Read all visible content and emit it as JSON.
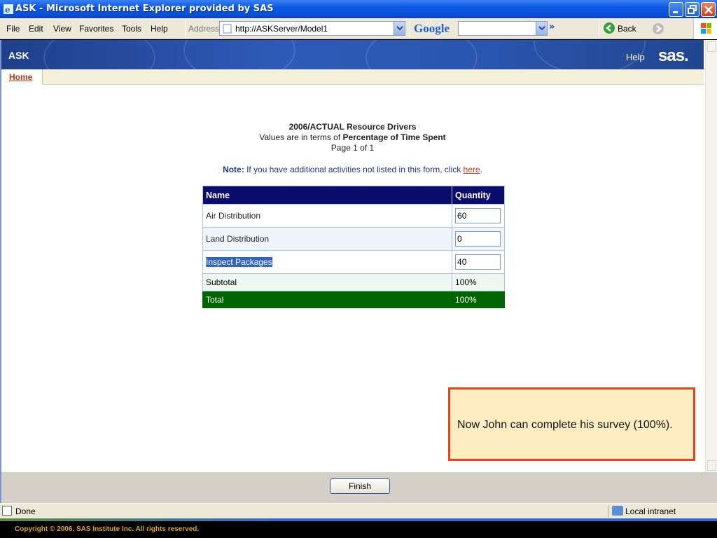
{
  "window": {
    "title": "ASK - Microsoft Internet Explorer provided by SAS"
  },
  "menu": {
    "file": "File",
    "edit": "Edit",
    "view": "View",
    "favorites": "Favorites",
    "tools": "Tools",
    "help": "Help"
  },
  "toolbar": {
    "address_label": "Address",
    "address_value": "http://ASKServer/Model1",
    "google_label": "Google",
    "back_label": "Back",
    "more": "»"
  },
  "app": {
    "name": "ASK",
    "help": "Help",
    "logo": "sas."
  },
  "tabs": [
    {
      "label": "Home"
    }
  ],
  "report": {
    "title": "2006/ACTUAL Resource Drivers",
    "values_prefix": "Values are in terms of ",
    "values_term": "Percentage of Time Spent",
    "page": "Page 1 of 1",
    "note_label": "Note:",
    "note_text": " If you have additional activities not listed in this form, click ",
    "note_link": "here",
    "note_end": "."
  },
  "table": {
    "headers": {
      "name": "Name",
      "quantity": "Quantity"
    },
    "rows": [
      {
        "name": "Air Distribution",
        "quantity": "60"
      },
      {
        "name": "Land Distribution",
        "quantity": "0"
      },
      {
        "name": "Inspect Packages",
        "quantity": "40"
      }
    ],
    "subtotal": {
      "label": "Subtotal",
      "value": "100%"
    },
    "total": {
      "label": "Total",
      "value": "100%"
    }
  },
  "callout": {
    "text": "Now John can complete his survey (100%)."
  },
  "actions": {
    "finish": "Finish"
  },
  "status": {
    "text": "Done",
    "zone": "Local intranet"
  },
  "footer": {
    "copyright": "Copyright © 2006, SAS Institute Inc. All rights reserved."
  },
  "colors": {
    "titlebar": "#0a58e4",
    "header_blue": "#0c0c6e",
    "total_green": "#006400",
    "callout_border": "#e1461b",
    "callout_bg": "#feedc0"
  }
}
